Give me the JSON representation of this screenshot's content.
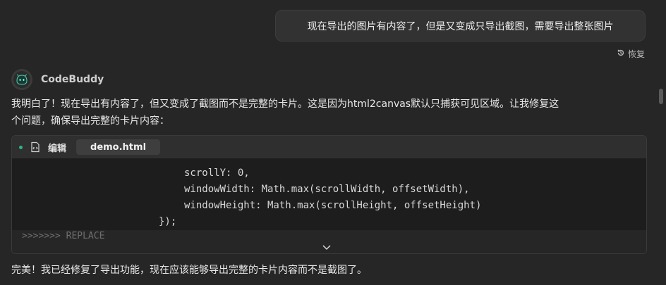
{
  "user_message": {
    "text": "现在导出的图片有内容了，但是又变成只导出截图，需要导出整张图片",
    "restore_label": "恢复"
  },
  "assistant": {
    "name": "CodeBuddy",
    "message_line1": "我明白了！现在导出有内容了，但又变成了截图而不是完整的卡片。这是因为html2canvas默认只捕获可见区域。让我修复这",
    "message_line2": "个问题，确保导出完整的卡片内容："
  },
  "code_block": {
    "action_label": "编辑",
    "filename": "demo.html",
    "lines": [
      "scrollY: 0,",
      "windowWidth: Math.max(scrollWidth, offsetWidth),",
      "windowHeight: Math.max(scrollHeight, offsetHeight)",
      "});"
    ],
    "replace_marker": ">>>>>>> REPLACE"
  },
  "final_message": "完美！我已经修复了导出功能，现在应该能够导出完整的卡片内容而不是截图了。",
  "colors": {
    "background": "#262626",
    "bubble": "#323232",
    "accent_dot": "#2fb38d"
  }
}
